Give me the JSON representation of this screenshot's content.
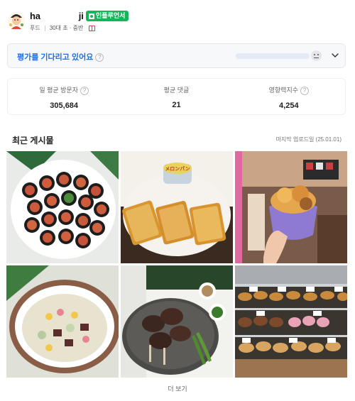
{
  "profile": {
    "name_start": "ha",
    "name_end": "ji",
    "badge": "인플루언서",
    "category": "푸드",
    "age": "30대 초 · 중반"
  },
  "rating": {
    "label": "평가를 기다리고 있어요",
    "help": "?"
  },
  "stats": [
    {
      "label": "일 평균 방문자",
      "value": "305,684",
      "has_help": true
    },
    {
      "label": "평균 댓글",
      "value": "21",
      "has_help": false
    },
    {
      "label": "영향력지수",
      "value": "4,254",
      "has_help": true
    }
  ],
  "posts_section": {
    "title": "최근 게시물",
    "last_upload": "마지막 업로드일 (25.01.01)",
    "more": "더 보기",
    "package_text": "メロンパン"
  },
  "colors": {
    "badge": "#18b45a",
    "rating_text": "#1f6fe0",
    "rating_bar": "#e3ebf6"
  }
}
